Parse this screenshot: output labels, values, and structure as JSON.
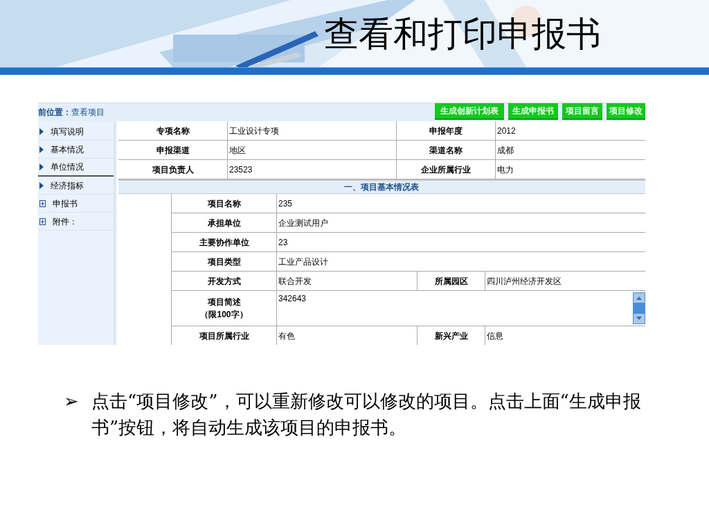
{
  "slide_title": "查看和打印申报书",
  "app": {
    "breadcrumb": {
      "label": "前位置：",
      "value": "查看项目"
    },
    "buttons": [
      "生成创新计划表",
      "生成申报书",
      "项目留言",
      "项目修改"
    ],
    "sidebar": [
      {
        "kind": "arrow",
        "label": "填写说明",
        "selected": false
      },
      {
        "kind": "arrow",
        "label": "基本情况",
        "selected": false
      },
      {
        "kind": "arrow",
        "label": "单位情况",
        "selected": true
      },
      {
        "kind": "arrow",
        "label": "经济指标",
        "selected": false
      },
      {
        "kind": "plus",
        "label": "申报书",
        "selected": false
      },
      {
        "kind": "plus",
        "label": "附件：",
        "selected": false
      }
    ],
    "header_rows": [
      {
        "label": "专项名称",
        "value": "工业设计专项",
        "label_2": "申报年度",
        "value_2": "2012"
      },
      {
        "label": "申报渠道",
        "value": "地区",
        "label_2": "渠道名称",
        "value_2": "成都"
      },
      {
        "label": "项目负责人",
        "value": "23523",
        "label_2": "企业所属行业",
        "value_2": "电力"
      }
    ],
    "section_title": "一、项目基本情况表",
    "detail_rows": [
      {
        "kind": "text",
        "label": "项目名称",
        "value": "235"
      },
      {
        "kind": "text",
        "label": "承担单位",
        "value": "企业测试用户"
      },
      {
        "kind": "text",
        "label": "主要协作单位",
        "value": "23"
      },
      {
        "kind": "text",
        "label": "项目类型",
        "value": "工业产品设计"
      },
      {
        "kind": "pair",
        "label": "开发方式",
        "value": "联合开发",
        "label_2": "所属园区",
        "value_2": "四川泸州经济开发区"
      },
      {
        "kind": "textarea",
        "label": "项目简述",
        "note": "（限100字）",
        "value": "342643"
      },
      {
        "kind": "pair",
        "label": "项目所属行业",
        "value": "有色",
        "label_2": "新兴产业",
        "value_2": "信息"
      }
    ]
  },
  "bullet": {
    "marker": "➢",
    "text": "点击“项目修改”，可以重新修改可以修改的项目。点击上面“生成申报书”按钮，将自动生成该项目的申报书。"
  }
}
